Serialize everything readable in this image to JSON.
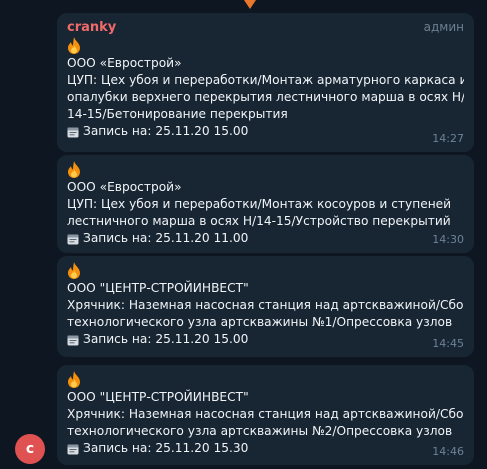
{
  "colors": {
    "background": "#0e1621",
    "bubble": "#182533",
    "author": "#f06a6a",
    "avatar": "#e05252"
  },
  "avatar_letter": "c",
  "messages": [
    {
      "author": "cranky",
      "role": "админ",
      "emoji": "fire-icon",
      "company": "ООО «Еврострой»",
      "body_lines": [
        "ЦУП: Цех убоя и переработки/Монтаж арматурного каркаса и",
        "опалубки верхнего перекрытия лестничного марша в осях Н/",
        "14-15/Бетонирование перекрытия"
      ],
      "record": "Запись на: 25.11.20 15.00",
      "time": "14:27"
    },
    {
      "emoji": "fire-icon",
      "company": "ООО «Еврострой»",
      "body_lines": [
        "ЦУП: Цех убоя и переработки/Монтаж косоуров и ступеней",
        "лестничного марша в осях Н/14-15/Устройство перекрытий"
      ],
      "record": "Запись на: 25.11.20 11.00",
      "time": "14:30"
    },
    {
      "emoji": "fire-icon",
      "company": "ООО \"ЦЕНТР-СТРОЙИНВЕСТ\"",
      "body_lines": [
        "Хрячник: Наземная насосная станция над артскважиной/Сборка",
        "технологического узла артскважины №1/Опрессовка узлов"
      ],
      "record": "Запись на: 25.11.20 15.00",
      "time": "14:45"
    },
    {
      "emoji": "fire-icon",
      "company": "ООО \"ЦЕНТР-СТРОЙИНВЕСТ\"",
      "body_lines": [
        "Хрячник: Наземная насосная станция над артскважиной/Сборка",
        "технологического узла артскважины №2/Опрессовка узлов"
      ],
      "record": "Запись на: 25.11.20 15.30",
      "time": "14:46"
    }
  ]
}
